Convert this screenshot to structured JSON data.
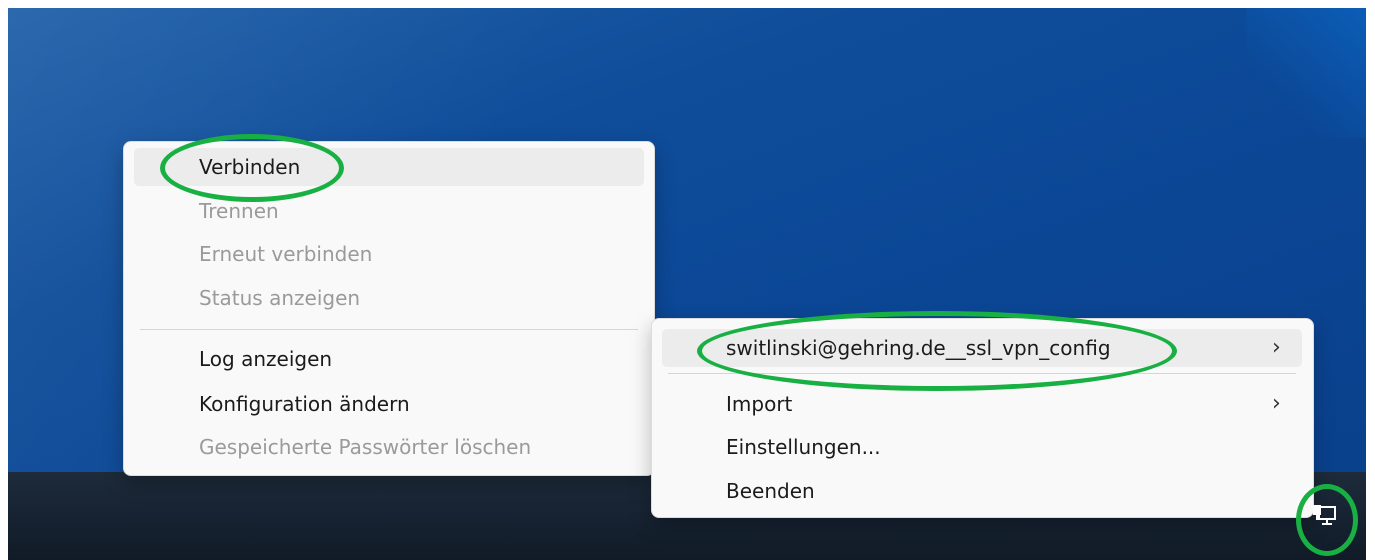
{
  "context_menu": {
    "items": [
      {
        "label": "Verbinden",
        "enabled": true
      },
      {
        "label": "Trennen",
        "enabled": false
      },
      {
        "label": "Erneut verbinden",
        "enabled": false
      },
      {
        "label": "Status anzeigen",
        "enabled": false
      },
      {
        "label": "Log anzeigen",
        "enabled": true
      },
      {
        "label": "Konfiguration ändern",
        "enabled": true
      },
      {
        "label": "Gespeicherte Passwörter löschen",
        "enabled": false
      }
    ]
  },
  "tray_menu": {
    "items": [
      {
        "label": "switlinski@gehring.de__ssl_vpn_config",
        "has_submenu": true
      },
      {
        "label": "Import",
        "has_submenu": true
      },
      {
        "label": "Einstellungen...",
        "has_submenu": false
      },
      {
        "label": "Beenden",
        "has_submenu": false
      }
    ]
  },
  "colors": {
    "highlight_ring": "#19b043",
    "menu_bg": "#f9f9f9"
  },
  "icons": {
    "submenu_arrow": "chevron-right-icon",
    "tray": "network-tray-icon"
  }
}
